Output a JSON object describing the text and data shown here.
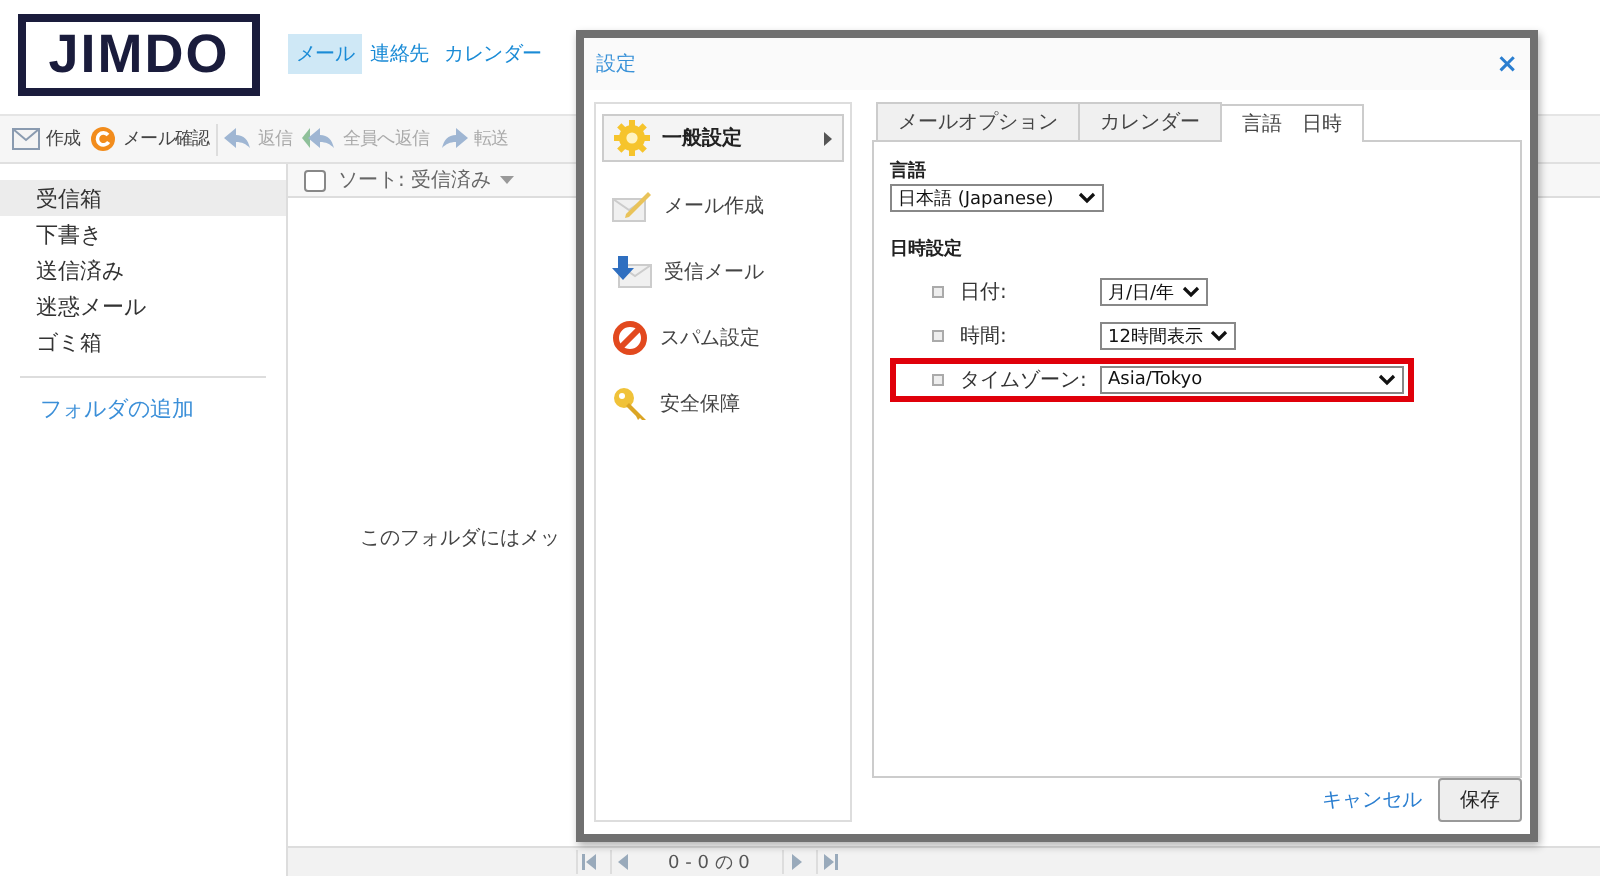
{
  "logo": {
    "text": "JIMDO"
  },
  "nav": [
    {
      "label": "メール",
      "selected": true
    },
    {
      "label": "連絡先",
      "selected": false
    },
    {
      "label": "カレンダー",
      "selected": false
    }
  ],
  "toolbar": [
    {
      "label": "作成",
      "kind": "compose",
      "disabled": false
    },
    {
      "label": "メール確認",
      "kind": "check",
      "disabled": false
    },
    {
      "label": "返信",
      "kind": "reply",
      "disabled": true
    },
    {
      "label": "全員へ返信",
      "kind": "replyall",
      "disabled": true
    },
    {
      "label": "転送",
      "kind": "forward",
      "disabled": true
    }
  ],
  "folders": [
    {
      "label": "受信箱",
      "selected": true
    },
    {
      "label": "下書き",
      "selected": false
    },
    {
      "label": "送信済み",
      "selected": false
    },
    {
      "label": "迷惑メール",
      "selected": false
    },
    {
      "label": "ゴミ箱",
      "selected": false
    }
  ],
  "add_folder": "フォルダの追加",
  "list": {
    "select_all_checked": false,
    "sort": "ソート: 受信済み",
    "empty_message": "このフォルダにはメッ",
    "pager": "0 - 0 の 0"
  },
  "dialog": {
    "title": "設定",
    "close": "×",
    "sections": [
      {
        "label": "一般設定",
        "kind": "general",
        "selected": true
      },
      {
        "label": "メール作成",
        "kind": "compose",
        "selected": false
      },
      {
        "label": "受信メール",
        "kind": "incoming",
        "selected": false
      },
      {
        "label": "スパム設定",
        "kind": "spam",
        "selected": false
      },
      {
        "label": "安全保障",
        "kind": "security",
        "selected": false
      }
    ],
    "tabs": [
      {
        "label": "メールオプション",
        "selected": false
      },
      {
        "label": "カレンダー",
        "selected": false
      },
      {
        "label": "言語　日時",
        "selected": true
      }
    ],
    "language": {
      "label": "言語",
      "value": "日本語 (Japanese)"
    },
    "datetime": {
      "heading": "日時設定",
      "fields": [
        {
          "label": "日付:",
          "value": "月/日/年",
          "highlighted": false
        },
        {
          "label": "時間:",
          "value": "12時間表示",
          "highlighted": false
        },
        {
          "label": "タイムゾーン:",
          "value": "Asia/Tokyo",
          "highlighted": true
        }
      ]
    },
    "cancel": "キャンセル",
    "save": "保存"
  }
}
